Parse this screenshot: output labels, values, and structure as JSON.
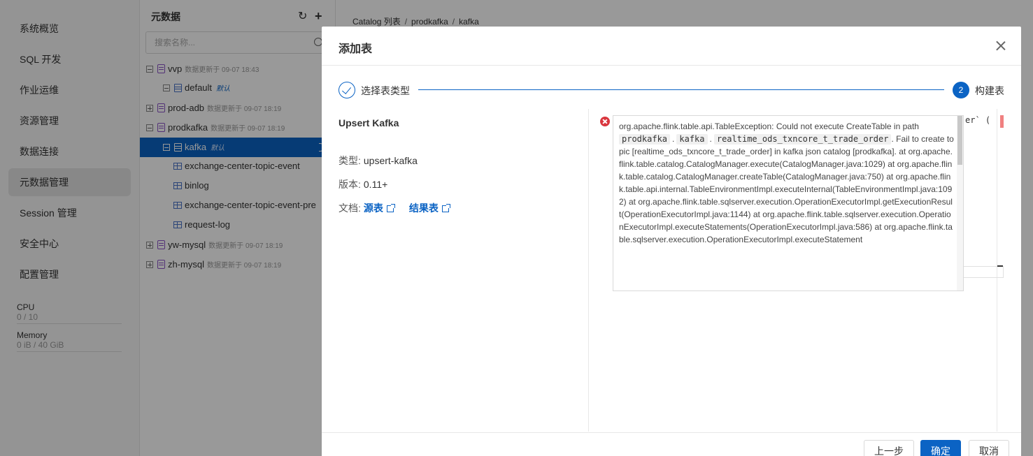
{
  "sidebar": {
    "items": [
      {
        "label": "系统概览"
      },
      {
        "label": "SQL 开发"
      },
      {
        "label": "作业运维"
      },
      {
        "label": "资源管理"
      },
      {
        "label": "数据连接"
      },
      {
        "label": "元数据管理",
        "active": true
      },
      {
        "label": "Session 管理"
      },
      {
        "label": "安全中心"
      },
      {
        "label": "配置管理"
      }
    ],
    "resources": {
      "cpu_label": "CPU",
      "cpu_value": "0 / 10",
      "memory_label": "Memory",
      "memory_value": "0 iB / 40 GiB"
    }
  },
  "tree": {
    "title": "元数据",
    "refresh_icon": "refresh-icon",
    "add_icon": "plus-icon",
    "search_placeholder": "搜索名称...",
    "nodes": [
      {
        "label": "vvp",
        "meta": "数据更新于 09-07 18:43",
        "expanded": true
      },
      {
        "label": "default",
        "badge": "默认"
      },
      {
        "label": "prod-adb",
        "meta": "数据更新于 09-07 18:19"
      },
      {
        "label": "prodkafka",
        "meta": "数据更新于 09-07 18:19",
        "expanded": true
      },
      {
        "label": "kafka",
        "badge": "默认",
        "selected": true
      },
      {
        "label": "exchange-center-topic-event"
      },
      {
        "label": "binlog"
      },
      {
        "label": "exchange-center-topic-event-pre"
      },
      {
        "label": "request-log"
      },
      {
        "label": "yw-mysql",
        "meta": "数据更新于 09-07 18:19"
      },
      {
        "label": "zh-mysql",
        "meta": "数据更新于 09-07 18:19"
      }
    ]
  },
  "breadcrumb": {
    "items": [
      "Catalog 列表",
      "prodkafka",
      "kafka"
    ],
    "separator": "/"
  },
  "modal": {
    "title": "添加表",
    "steps": [
      {
        "label": "选择表类型",
        "status": "done"
      },
      {
        "number": "2",
        "label": "构建表",
        "status": "active"
      }
    ],
    "connector": {
      "name": "Upsert Kafka",
      "type_label": "类型:",
      "type_value": "upsert-kafka",
      "version_label": "版本:",
      "version_value": "0.11+",
      "docs_label": "文档:",
      "doc_source": "源表",
      "doc_sink": "结果表"
    },
    "editor": {
      "visible_fragment": "er` ("
    },
    "error": {
      "line1": "org.apache.flink.table.api.TableException: Could not execute CreateTable in path",
      "chips": [
        "prodkafka",
        "kafka",
        "realtime_ods_txncore_t_trade_order"
      ],
      "line2_suffix": ". Fail to create topic [realtime_ods_txncore_t_trade_order] in kafka json catalog [prodkafka]. at org.apache.flink.table.catalog.CatalogManager.execute(CatalogManager.java:1029) at org.apache.flink.table.catalog.CatalogManager.createTable(CatalogManager.java:750) at org.apache.flink.table.api.internal.TableEnvironmentImpl.executeInternal(TableEnvironmentImpl.java:1092) at org.apache.flink.table.sqlserver.execution.OperationExecutorImpl.getExecutionResult(OperationExecutorImpl.java:1144) at org.apache.flink.table.sqlserver.execution.OperationExecutorImpl.executeStatements(OperationExecutorImpl.java:586) at org.apache.flink.table.sqlserver.execution.OperationExecutorImpl.executeStatement"
    },
    "buttons": {
      "prev": "上一步",
      "ok": "确定",
      "cancel": "取消"
    }
  },
  "colors": {
    "primary": "#0b63c4",
    "error": "#d9363e",
    "db_icon": "#8a52c6"
  }
}
